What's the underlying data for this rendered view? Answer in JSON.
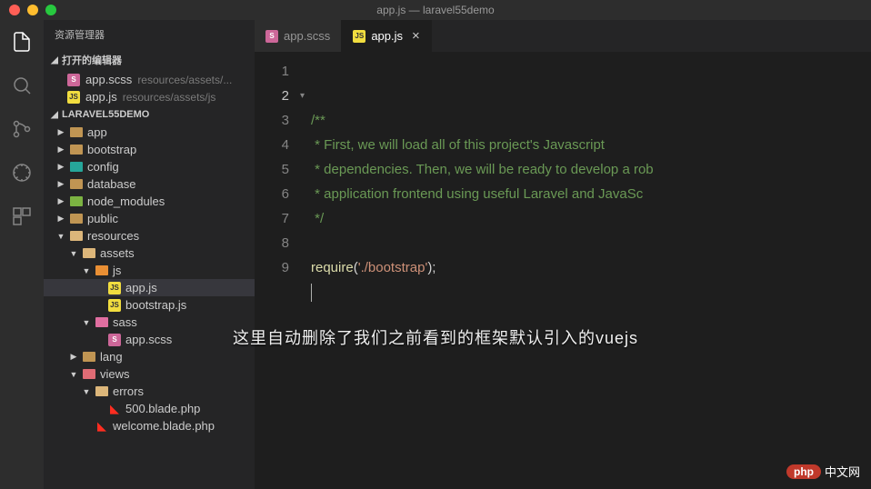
{
  "window": {
    "title": "app.js — laravel55demo"
  },
  "sidebar": {
    "title": "资源管理器",
    "openEditors": {
      "header": "打开的编辑器",
      "items": [
        {
          "icon": "scss",
          "name": "app.scss",
          "path": "resources/assets/..."
        },
        {
          "icon": "js",
          "name": "app.js",
          "path": "resources/assets/js"
        }
      ]
    },
    "project": {
      "header": "LARAVEL55DEMO",
      "tree": [
        {
          "depth": 0,
          "chev": "▶",
          "type": "folder",
          "label": "app"
        },
        {
          "depth": 0,
          "chev": "▶",
          "type": "folder",
          "label": "bootstrap"
        },
        {
          "depth": 0,
          "chev": "▶",
          "type": "folder-teal",
          "label": "config"
        },
        {
          "depth": 0,
          "chev": "▶",
          "type": "folder",
          "label": "database"
        },
        {
          "depth": 0,
          "chev": "▶",
          "type": "folder-green",
          "label": "node_modules"
        },
        {
          "depth": 0,
          "chev": "▶",
          "type": "folder",
          "label": "public"
        },
        {
          "depth": 0,
          "chev": "▼",
          "type": "folder-open",
          "label": "resources"
        },
        {
          "depth": 1,
          "chev": "▼",
          "type": "folder-open",
          "label": "assets"
        },
        {
          "depth": 2,
          "chev": "▼",
          "type": "folder-orange",
          "label": "js"
        },
        {
          "depth": 3,
          "chev": "",
          "type": "js",
          "label": "app.js",
          "selected": true
        },
        {
          "depth": 3,
          "chev": "",
          "type": "js",
          "label": "bootstrap.js"
        },
        {
          "depth": 2,
          "chev": "▼",
          "type": "folder-pink",
          "label": "sass"
        },
        {
          "depth": 3,
          "chev": "",
          "type": "scss",
          "label": "app.scss"
        },
        {
          "depth": 1,
          "chev": "▶",
          "type": "folder",
          "label": "lang"
        },
        {
          "depth": 1,
          "chev": "▼",
          "type": "folder-red",
          "label": "views"
        },
        {
          "depth": 2,
          "chev": "▼",
          "type": "folder-open",
          "label": "errors"
        },
        {
          "depth": 3,
          "chev": "",
          "type": "laravel",
          "label": "500.blade.php"
        },
        {
          "depth": 2,
          "chev": "",
          "type": "laravel",
          "label": "welcome.blade.php"
        }
      ]
    }
  },
  "tabs": [
    {
      "icon": "scss",
      "label": "app.scss",
      "active": false
    },
    {
      "icon": "js",
      "label": "app.js",
      "active": true,
      "closable": true
    }
  ],
  "code": {
    "lines": [
      "1",
      "2",
      "3",
      "4",
      "5",
      "6",
      "7",
      "8",
      "9"
    ],
    "l2": "/**",
    "l3": " * First, we will load all of this project's Javascript",
    "l4": " * dependencies. Then, we will be ready to develop a rob",
    "l5": " * application frontend using useful Laravel and JavaSc",
    "l6": " */",
    "require": "require",
    "str": "'./bootstrap'"
  },
  "overlay": "这里自动删除了我们之前看到的框架默认引入的vuejs",
  "watermark": {
    "badge": "php",
    "text": "中文网"
  }
}
